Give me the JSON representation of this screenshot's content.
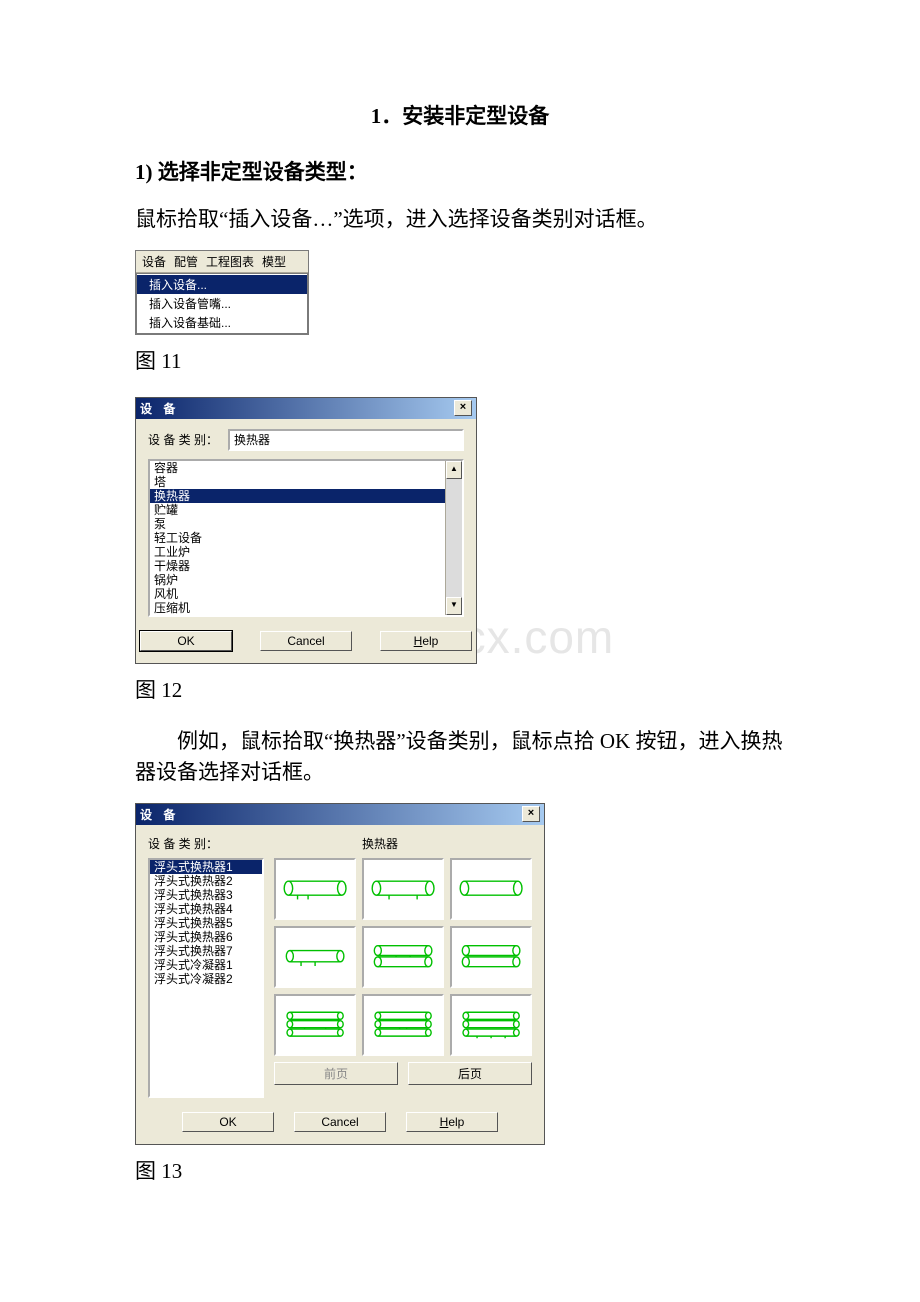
{
  "headings": {
    "section": "1．安装非定型设备",
    "sub1": "1) 选择非定型设备类型："
  },
  "paragraphs": {
    "p1": "鼠标拾取“插入设备…”选项，进入选择设备类别对话框。",
    "p2": "例如，鼠标拾取“换热器”设备类别，鼠标点拾 OK 按钮，进入换热器设备选择对话框。"
  },
  "fig_labels": {
    "f11": "图 11",
    "f12": "图 12",
    "f13": "图 13"
  },
  "watermark": "www.bdocx.com",
  "menu": {
    "bar": [
      "设备",
      "配管",
      "工程图表",
      "模型"
    ],
    "items": [
      "插入设备...",
      "插入设备管嘴...",
      "插入设备基础..."
    ]
  },
  "dialog1": {
    "title": "设  备",
    "category_label": "设 备 类 别：",
    "category_value": "换热器",
    "items": [
      "容器",
      "塔",
      "换热器",
      "贮罐",
      "泵",
      "轻工设备",
      "工业炉",
      "干燥器",
      "锅炉",
      "风机",
      "压缩机"
    ],
    "buttons": {
      "ok": "OK",
      "cancel": "Cancel",
      "help": "Help"
    }
  },
  "dialog2": {
    "title": "设  备",
    "category_label": "设 备 类 别：",
    "category_value": "换热器",
    "items": [
      "浮头式换热器1",
      "浮头式换热器2",
      "浮头式换热器3",
      "浮头式换热器4",
      "浮头式换热器5",
      "浮头式换热器6",
      "浮头式换热器7",
      "浮头式冷凝器1",
      "浮头式冷凝器2"
    ],
    "pager_prev": "前页",
    "pager_next": "后页",
    "buttons": {
      "ok": "OK",
      "cancel": "Cancel",
      "help": "Help"
    }
  }
}
